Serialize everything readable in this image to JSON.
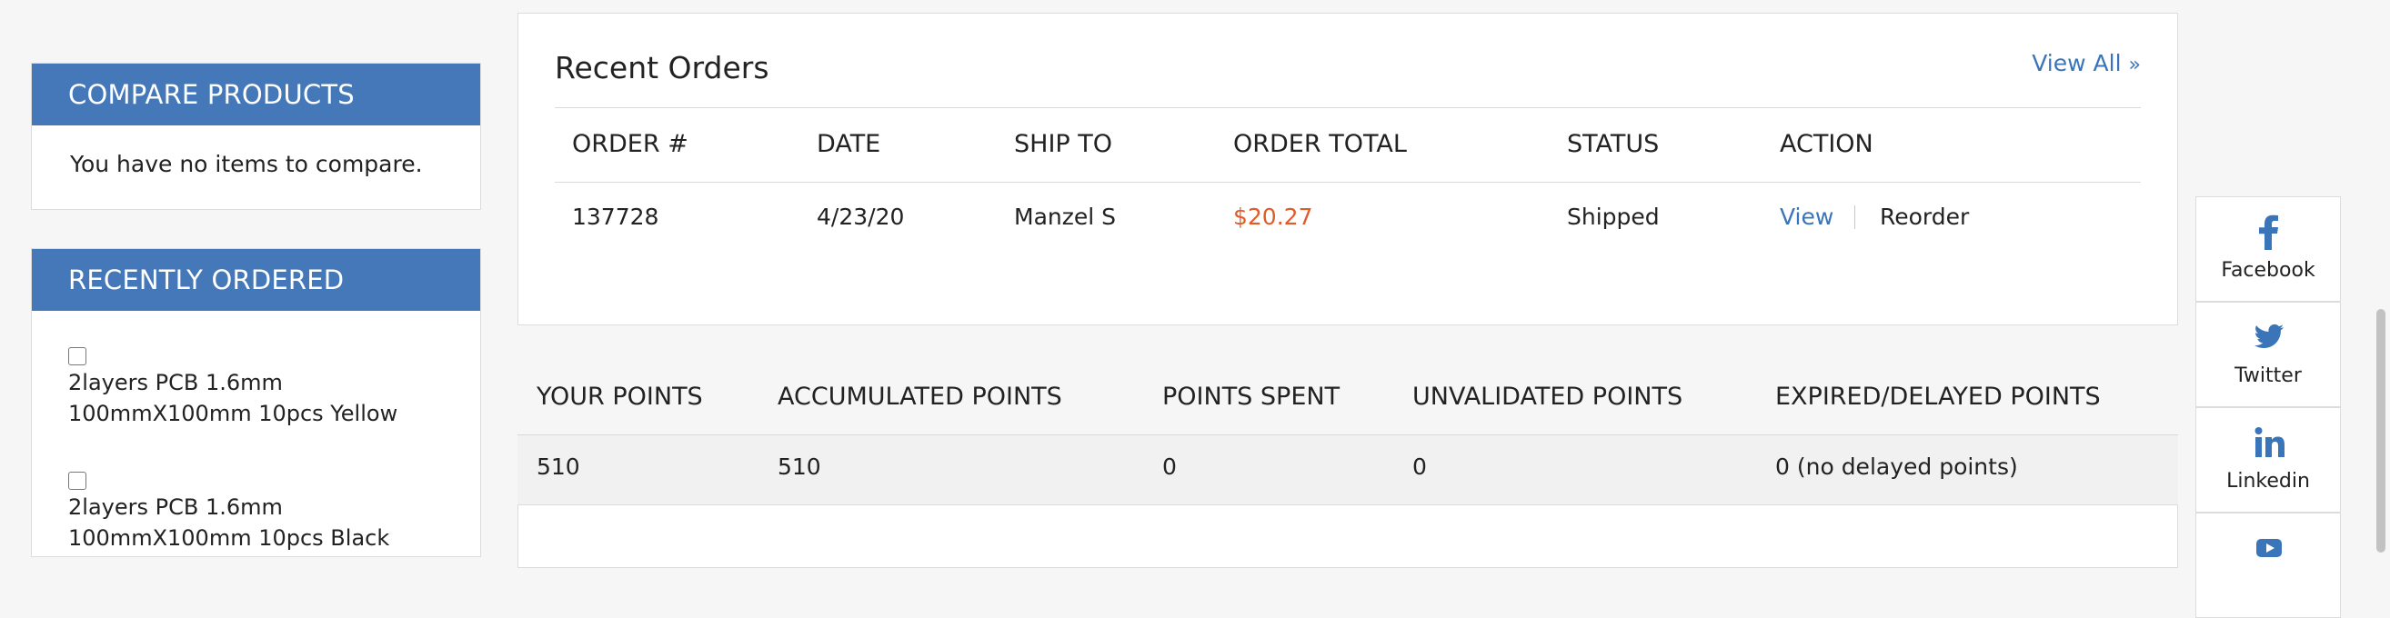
{
  "compare": {
    "title": "COMPARE PRODUCTS",
    "empty_text": "You have no items to compare."
  },
  "recently_ordered": {
    "title": "RECENTLY ORDERED",
    "items": [
      {
        "name": "2layers PCB 1.6mm 100mmX100mm 10pcs Yellow"
      },
      {
        "name": "2layers PCB 1.6mm 100mmX100mm 10pcs Black"
      }
    ]
  },
  "recent_orders": {
    "title": "Recent Orders",
    "view_all": "View All",
    "view_all_icon": "double-chevron-right-icon",
    "columns": [
      "ORDER #",
      "DATE",
      "SHIP TO",
      "ORDER TOTAL",
      "STATUS",
      "ACTION"
    ],
    "rows": [
      {
        "order": "137728",
        "date": "4/23/20",
        "ship_to": "Manzel S",
        "total": "$20.27",
        "status": "Shipped",
        "view": "View",
        "reorder": "Reorder"
      }
    ]
  },
  "points": {
    "columns": [
      "YOUR POINTS",
      "ACCUMULATED POINTS",
      "POINTS SPENT",
      "UNVALIDATED POINTS",
      "EXPIRED/DELAYED POINTS"
    ],
    "values": [
      "510",
      "510",
      "0",
      "0",
      "0 (no delayed points)"
    ]
  },
  "social": [
    {
      "label": "Facebook",
      "icon": "facebook-icon"
    },
    {
      "label": "Twitter",
      "icon": "twitter-icon"
    },
    {
      "label": "Linkedin",
      "icon": "linkedin-icon"
    },
    {
      "label": "",
      "icon": "youtube-icon"
    }
  ],
  "colors": {
    "accent": "#4478b8",
    "link": "#3a75b9",
    "price": "#e05a2a"
  }
}
